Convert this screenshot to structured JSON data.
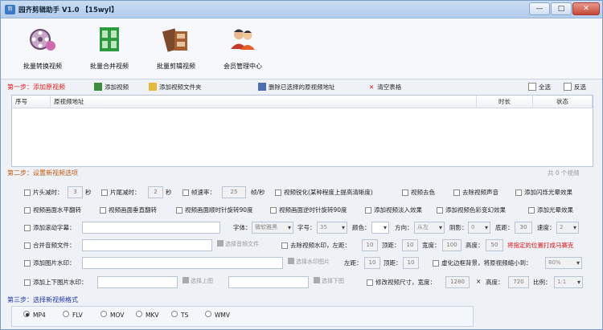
{
  "window": {
    "title": "园齐剪辑助手 V1.0 【15wyl】",
    "min": "—",
    "max": "□",
    "close": "✕"
  },
  "tools": [
    {
      "label": "批量转换视频",
      "icon": "film-reel-icon"
    },
    {
      "label": "批量合并视频",
      "icon": "film-strip-icon"
    },
    {
      "label": "批量剪辑视频",
      "icon": "clapper-film-icon"
    },
    {
      "label": "会员管理中心",
      "icon": "members-icon"
    }
  ],
  "step1": {
    "title": "第一步：添加原视频",
    "add_video": "添加视频",
    "add_folder": "添加视频文件夹",
    "delete_selected": "删除已选择的原视频地址",
    "clear_table": "清空表格",
    "select_all": "全选",
    "invert": "反选"
  },
  "table": {
    "columns": [
      "序号",
      "原视频地址",
      "时长",
      "状态"
    ],
    "rows": []
  },
  "step2": {
    "title": "第二步：设置新视频选项",
    "count": "共 0 个视频"
  },
  "options": {
    "head_cut": "片头减时：",
    "head_val": "3",
    "sec": "秒",
    "tail_cut": "片尾减时：",
    "tail_val": "2",
    "sec2": "秒",
    "framerate": "帧速率：",
    "framerate_val": "25",
    "fps_unit": "帧/秒",
    "sharpen": "视频锐化(某种程度上提高清晰度)",
    "decolor": "视频去色",
    "mute": "去除视频声音",
    "flash": "添加闪烁光晕效果",
    "hflip": "视频画面水平翻转",
    "vflip": "视频画面垂直翻转",
    "rot_cw": "视频画面顺时针旋转90度",
    "rot_ccw": "视频画面逆时针旋转90度",
    "fade_in": "添加视频淡入效果",
    "color_change": "添加视频色彩变幻效果",
    "glow": "添加光晕效果",
    "scroll_text": "添加滚动字幕：",
    "font": "字体：",
    "font_val": "微软雅黑",
    "size": "字号：",
    "size_val": "35",
    "color": "颜色：",
    "direction": "方向：",
    "direction_val": "从左",
    "shadow": "阴影：",
    "shadow_val": "0",
    "margin": "底距：",
    "margin_val": "30",
    "speed": "速度：",
    "speed_val": "2",
    "merge_audio": "合并音频文件：",
    "choose_audio": "选择音频文件",
    "remove_wm": "去除视频水印，左距：",
    "wm_left": "10",
    "top": "顶距：",
    "wm_top": "10",
    "width": "宽度：",
    "wm_width": "100",
    "height": "高度：",
    "wm_height": "50",
    "wm_hint": "将指定的位置打成马赛克",
    "img_wm": "添加图片水印：",
    "choose_wm": "选择水印图片",
    "left": "左距：",
    "img_left": "10",
    "top2": "顶距：",
    "img_top": "10",
    "blur_border": "虚化边框背景，将原视频缩小到：",
    "blur_val": "80%",
    "top_bottom": "添加上下图片水印：",
    "choose_top": "选择上图",
    "choose_bottom": "选择下图",
    "resize": "修改视频尺寸，宽度：",
    "resize_w": "1280",
    "x": "×",
    "height2": "高度：",
    "resize_h": "720",
    "ratio": "比例：",
    "ratio_val": "1:1"
  },
  "step3": {
    "title": "第三步：选择新视频格式",
    "formats": [
      "MP4",
      "FLV",
      "MOV",
      "MKV",
      "TS",
      "WMV"
    ],
    "selected": "MP4"
  }
}
